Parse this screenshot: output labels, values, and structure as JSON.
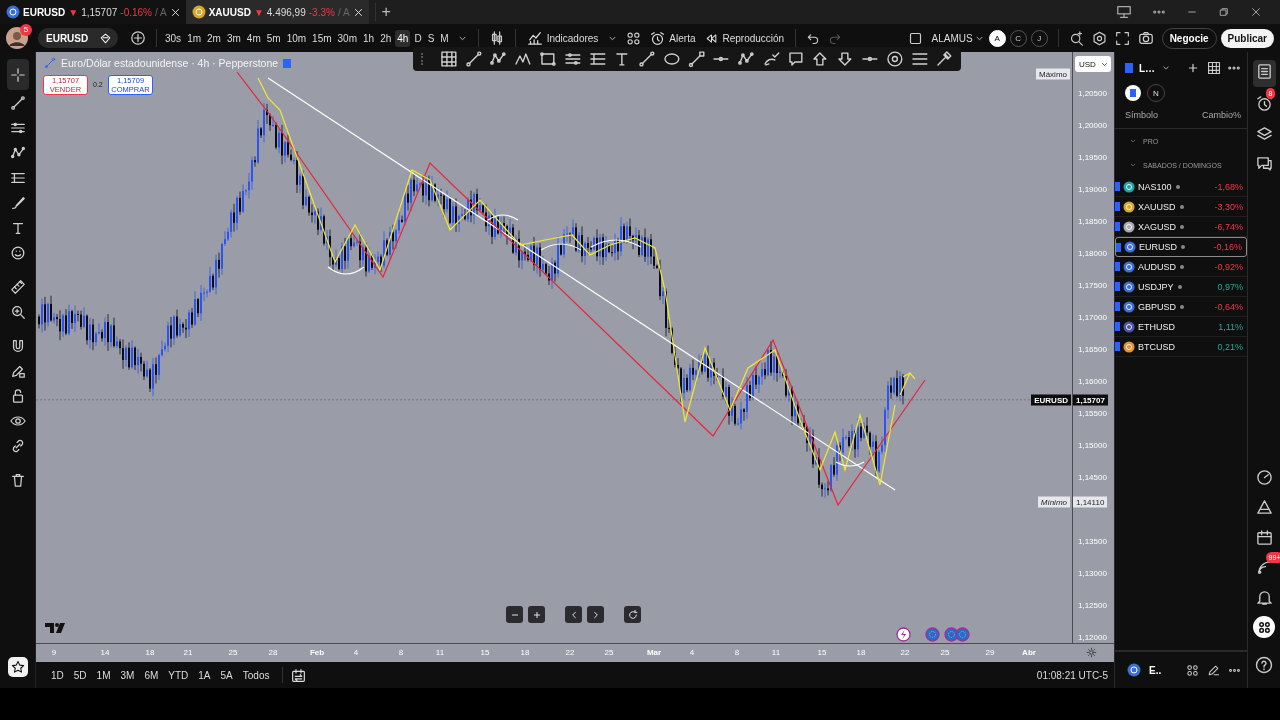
{
  "window_tabs": [
    {
      "symbol": "EURUSD",
      "arrow": "▼",
      "price": "1,15707",
      "change": "-0.16%",
      "suffix": "/ A",
      "color": "#3b6fd8",
      "selected": true
    },
    {
      "symbol": "XAUUSD",
      "arrow": "▼",
      "price": "4.496,99",
      "change": "-3.3%",
      "suffix": "/ A",
      "color": "#d9a628",
      "selected": false
    }
  ],
  "new_tab": "+",
  "toolbar": {
    "avatar_badge": "5",
    "symbol": "EURUSD",
    "intervals": [
      {
        "label": "30s",
        "selected": false
      },
      {
        "label": "1m",
        "selected": false
      },
      {
        "label": "2m",
        "selected": false
      },
      {
        "label": "3m",
        "selected": false
      },
      {
        "label": "4m",
        "selected": false
      },
      {
        "label": "5m",
        "selected": false
      },
      {
        "label": "10m",
        "selected": false
      },
      {
        "label": "15m",
        "selected": false
      },
      {
        "label": "30m",
        "selected": false
      },
      {
        "label": "1h",
        "selected": false
      },
      {
        "label": "2h",
        "selected": false
      },
      {
        "label": "4h",
        "selected": true
      },
      {
        "label": "D",
        "selected": false
      },
      {
        "label": "S",
        "selected": false
      },
      {
        "label": "M",
        "selected": false
      }
    ],
    "indicators": "Indicadores",
    "alert": "Alerta",
    "replay": "Reproducción",
    "layout_name": "ALAMUS",
    "accounts": [
      {
        "label": "A",
        "selected": true
      },
      {
        "label": "C",
        "selected": false
      },
      {
        "label": "J",
        "selected": false
      }
    ],
    "trade": "Negocie",
    "publish": "Publicar"
  },
  "chart": {
    "title": "Euro/Dólar estadounidense · 4h · Pepperstone",
    "sell": {
      "price": "1,15707",
      "label": "VENDER"
    },
    "spread": "0.2",
    "buy": {
      "price": "1,15709",
      "label": "COMPRAR"
    },
    "currency": "USD",
    "high_label": "Máximo",
    "price_labels": [
      "1,20500",
      "1,20000",
      "1,19500",
      "1,19000",
      "1,18500",
      "1,18000",
      "1,17500",
      "1,17000",
      "1,16500",
      "1,16000",
      "1,15500",
      "1,15000",
      "1,14500",
      "1,13500",
      "1,13000",
      "1,12500",
      "1,12000"
    ],
    "last": {
      "symbol": "EURUSD",
      "price": "1,15707"
    },
    "low": {
      "label": "Mínimo",
      "price": "1,14110"
    },
    "time_labels": [
      {
        "label": "9",
        "kind": "day"
      },
      {
        "label": "14",
        "kind": "day"
      },
      {
        "label": "18",
        "kind": "day"
      },
      {
        "label": "21",
        "kind": "day"
      },
      {
        "label": "25",
        "kind": "day"
      },
      {
        "label": "28",
        "kind": "day"
      },
      {
        "label": "Feb",
        "kind": "month"
      },
      {
        "label": "4",
        "kind": "day"
      },
      {
        "label": "8",
        "kind": "day"
      },
      {
        "label": "11",
        "kind": "day"
      },
      {
        "label": "15",
        "kind": "day"
      },
      {
        "label": "18",
        "kind": "day"
      },
      {
        "label": "22",
        "kind": "day"
      },
      {
        "label": "25",
        "kind": "day"
      },
      {
        "label": "Mar",
        "kind": "month"
      },
      {
        "label": "4",
        "kind": "day"
      },
      {
        "label": "8",
        "kind": "day"
      },
      {
        "label": "11",
        "kind": "day"
      },
      {
        "label": "15",
        "kind": "day"
      },
      {
        "label": "18",
        "kind": "day"
      },
      {
        "label": "22",
        "kind": "day"
      },
      {
        "label": "25",
        "kind": "day"
      },
      {
        "label": "29",
        "kind": "day"
      },
      {
        "label": "Abr",
        "kind": "month"
      }
    ]
  },
  "bottom_bar": {
    "ranges": [
      "1D",
      "5D",
      "1M",
      "3M",
      "6M",
      "YTD",
      "1A",
      "5A",
      "Todos"
    ],
    "clock": "01:08:21 UTC-5"
  },
  "watchlist": {
    "list_name": "L…",
    "filter": "N",
    "columns": [
      "Símbolo",
      "Cambio%"
    ],
    "groups": [
      "PRO",
      "SABADOS / DOMINGOS"
    ],
    "items": [
      {
        "symbol": "NAS100",
        "change": "-1,68%",
        "positive": false,
        "market_closed": true,
        "color": "#1fa3a8",
        "selected": false
      },
      {
        "symbol": "XAUUSD",
        "change": "-3,30%",
        "positive": false,
        "market_closed": true,
        "color": "#d9a628",
        "selected": false
      },
      {
        "symbol": "XAGUSD",
        "change": "-6,74%",
        "positive": false,
        "market_closed": true,
        "color": "#a9abb3",
        "selected": false
      },
      {
        "symbol": "EURUSD",
        "change": "-0,16%",
        "positive": false,
        "market_closed": true,
        "color": "#3b6fd8",
        "selected": true
      },
      {
        "symbol": "AUDUSD",
        "change": "-0,92%",
        "positive": false,
        "market_closed": true,
        "color": "#3b6fd8",
        "selected": false
      },
      {
        "symbol": "USDJPY",
        "change": "0,97%",
        "positive": true,
        "market_closed": true,
        "color": "#3b6fd8",
        "selected": false
      },
      {
        "symbol": "GBPUSD",
        "change": "-0,64%",
        "positive": false,
        "market_closed": true,
        "color": "#3b6fd8",
        "selected": false
      },
      {
        "symbol": "ETHUSD",
        "change": "1,11%",
        "positive": true,
        "market_closed": false,
        "color": "#4a55a8",
        "selected": false
      },
      {
        "symbol": "BTCUSD",
        "change": "0,21%",
        "positive": true,
        "market_closed": false,
        "color": "#e8912d",
        "selected": false
      }
    ],
    "footer_name": "E.."
  },
  "right_bar": {
    "alerts_badge": "8",
    "notifications_badge": "99+"
  }
}
